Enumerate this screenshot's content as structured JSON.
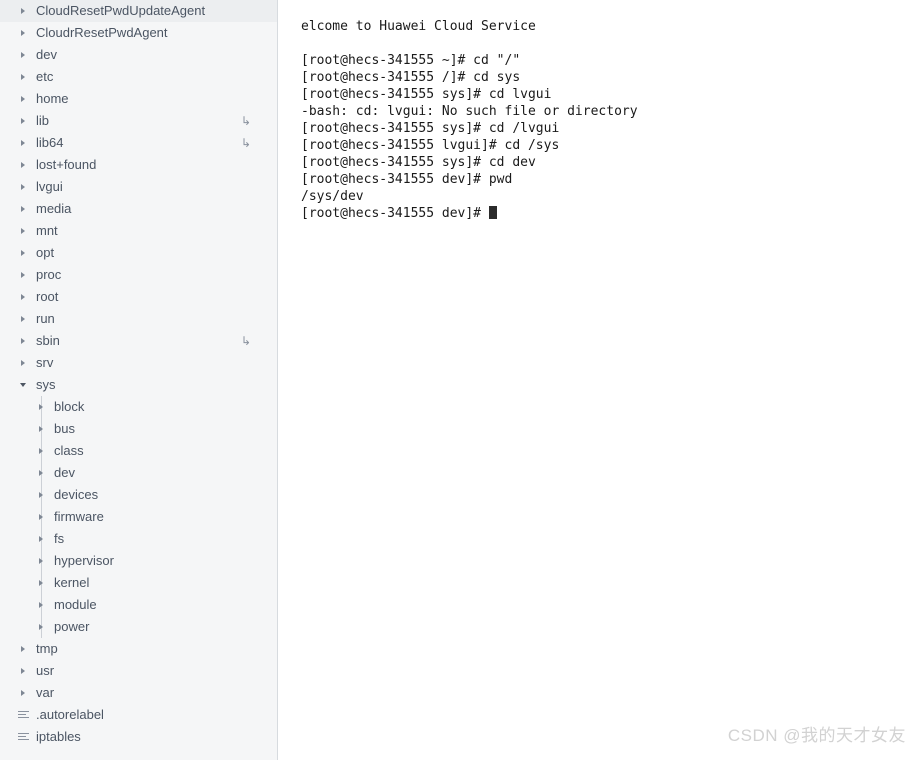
{
  "file_tree": {
    "name": "file-explorer",
    "items": [
      {
        "label": "CloudResetPwdUpdateAgent",
        "icon": "chevron-right-icon",
        "level": 0,
        "expanded": false,
        "symlink": false,
        "type": "directory"
      },
      {
        "label": "CloudrResetPwdAgent",
        "icon": "chevron-right-icon",
        "level": 0,
        "expanded": false,
        "symlink": false,
        "type": "directory"
      },
      {
        "label": "dev",
        "icon": "chevron-right-icon",
        "level": 0,
        "expanded": false,
        "symlink": false,
        "type": "directory"
      },
      {
        "label": "etc",
        "icon": "chevron-right-icon",
        "level": 0,
        "expanded": false,
        "symlink": false,
        "type": "directory"
      },
      {
        "label": "home",
        "icon": "chevron-right-icon",
        "level": 0,
        "expanded": false,
        "symlink": false,
        "type": "directory"
      },
      {
        "label": "lib",
        "icon": "chevron-right-icon",
        "level": 0,
        "expanded": false,
        "symlink": true,
        "type": "directory"
      },
      {
        "label": "lib64",
        "icon": "chevron-right-icon",
        "level": 0,
        "expanded": false,
        "symlink": true,
        "type": "directory"
      },
      {
        "label": "lost+found",
        "icon": "chevron-right-icon",
        "level": 0,
        "expanded": false,
        "symlink": false,
        "type": "directory"
      },
      {
        "label": "lvgui",
        "icon": "chevron-right-icon",
        "level": 0,
        "expanded": false,
        "symlink": false,
        "type": "directory"
      },
      {
        "label": "media",
        "icon": "chevron-right-icon",
        "level": 0,
        "expanded": false,
        "symlink": false,
        "type": "directory"
      },
      {
        "label": "mnt",
        "icon": "chevron-right-icon",
        "level": 0,
        "expanded": false,
        "symlink": false,
        "type": "directory"
      },
      {
        "label": "opt",
        "icon": "chevron-right-icon",
        "level": 0,
        "expanded": false,
        "symlink": false,
        "type": "directory"
      },
      {
        "label": "proc",
        "icon": "chevron-right-icon",
        "level": 0,
        "expanded": false,
        "symlink": false,
        "type": "directory"
      },
      {
        "label": "root",
        "icon": "chevron-right-icon",
        "level": 0,
        "expanded": false,
        "symlink": false,
        "type": "directory"
      },
      {
        "label": "run",
        "icon": "chevron-right-icon",
        "level": 0,
        "expanded": false,
        "symlink": false,
        "type": "directory"
      },
      {
        "label": "sbin",
        "icon": "chevron-right-icon",
        "level": 0,
        "expanded": false,
        "symlink": true,
        "type": "directory"
      },
      {
        "label": "srv",
        "icon": "chevron-right-icon",
        "level": 0,
        "expanded": false,
        "symlink": false,
        "type": "directory"
      },
      {
        "label": "sys",
        "icon": "chevron-down-icon",
        "level": 0,
        "expanded": true,
        "symlink": false,
        "type": "directory"
      },
      {
        "label": "block",
        "icon": "chevron-right-icon",
        "level": 1,
        "expanded": false,
        "symlink": false,
        "type": "directory"
      },
      {
        "label": "bus",
        "icon": "chevron-right-icon",
        "level": 1,
        "expanded": false,
        "symlink": false,
        "type": "directory"
      },
      {
        "label": "class",
        "icon": "chevron-right-icon",
        "level": 1,
        "expanded": false,
        "symlink": false,
        "type": "directory"
      },
      {
        "label": "dev",
        "icon": "chevron-right-icon",
        "level": 1,
        "expanded": false,
        "symlink": false,
        "type": "directory"
      },
      {
        "label": "devices",
        "icon": "chevron-right-icon",
        "level": 1,
        "expanded": false,
        "symlink": false,
        "type": "directory"
      },
      {
        "label": "firmware",
        "icon": "chevron-right-icon",
        "level": 1,
        "expanded": false,
        "symlink": false,
        "type": "directory"
      },
      {
        "label": "fs",
        "icon": "chevron-right-icon",
        "level": 1,
        "expanded": false,
        "symlink": false,
        "type": "directory"
      },
      {
        "label": "hypervisor",
        "icon": "chevron-right-icon",
        "level": 1,
        "expanded": false,
        "symlink": false,
        "type": "directory"
      },
      {
        "label": "kernel",
        "icon": "chevron-right-icon",
        "level": 1,
        "expanded": false,
        "symlink": false,
        "type": "directory"
      },
      {
        "label": "module",
        "icon": "chevron-right-icon",
        "level": 1,
        "expanded": false,
        "symlink": false,
        "type": "directory"
      },
      {
        "label": "power",
        "icon": "chevron-right-icon",
        "level": 1,
        "expanded": false,
        "symlink": false,
        "type": "directory"
      },
      {
        "label": "tmp",
        "icon": "chevron-right-icon",
        "level": 0,
        "expanded": false,
        "symlink": false,
        "type": "directory"
      },
      {
        "label": "usr",
        "icon": "chevron-right-icon",
        "level": 0,
        "expanded": false,
        "symlink": false,
        "type": "directory"
      },
      {
        "label": "var",
        "icon": "chevron-right-icon",
        "level": 0,
        "expanded": false,
        "symlink": false,
        "type": "directory"
      },
      {
        "label": ".autorelabel",
        "icon": "file-lines-icon",
        "level": 0,
        "expanded": false,
        "symlink": false,
        "type": "file"
      },
      {
        "label": "iptables",
        "icon": "file-lines-icon",
        "level": 0,
        "expanded": false,
        "symlink": false,
        "type": "file"
      }
    ],
    "symlink_glyph": "↳"
  },
  "terminal": {
    "name": "ssh-terminal",
    "lines": [
      "elcome to Huawei Cloud Service",
      "",
      "[root@hecs-341555 ~]# cd \"/\"",
      "[root@hecs-341555 /]# cd sys",
      "[root@hecs-341555 sys]# cd lvgui",
      "-bash: cd: lvgui: No such file or directory",
      "[root@hecs-341555 sys]# cd /lvgui",
      "[root@hecs-341555 lvgui]# cd /sys",
      "[root@hecs-341555 sys]# cd dev",
      "[root@hecs-341555 dev]# pwd",
      "/sys/dev"
    ],
    "prompt": "[root@hecs-341555 dev]# ",
    "cursor": "block"
  },
  "watermark": {
    "text": "CSDN @我的天才女友"
  },
  "colors": {
    "sidebar_bg": "#f5f6f7",
    "sidebar_border": "#d7dbdf",
    "tree_text": "#4b5563",
    "chevron": "#7e8794",
    "terminal_bg": "#ffffff",
    "terminal_text": "#1a1a1a",
    "cursor": "#2b2b2b",
    "watermark": "#d2d2d2",
    "indent_guide": "#ccd0d6"
  }
}
